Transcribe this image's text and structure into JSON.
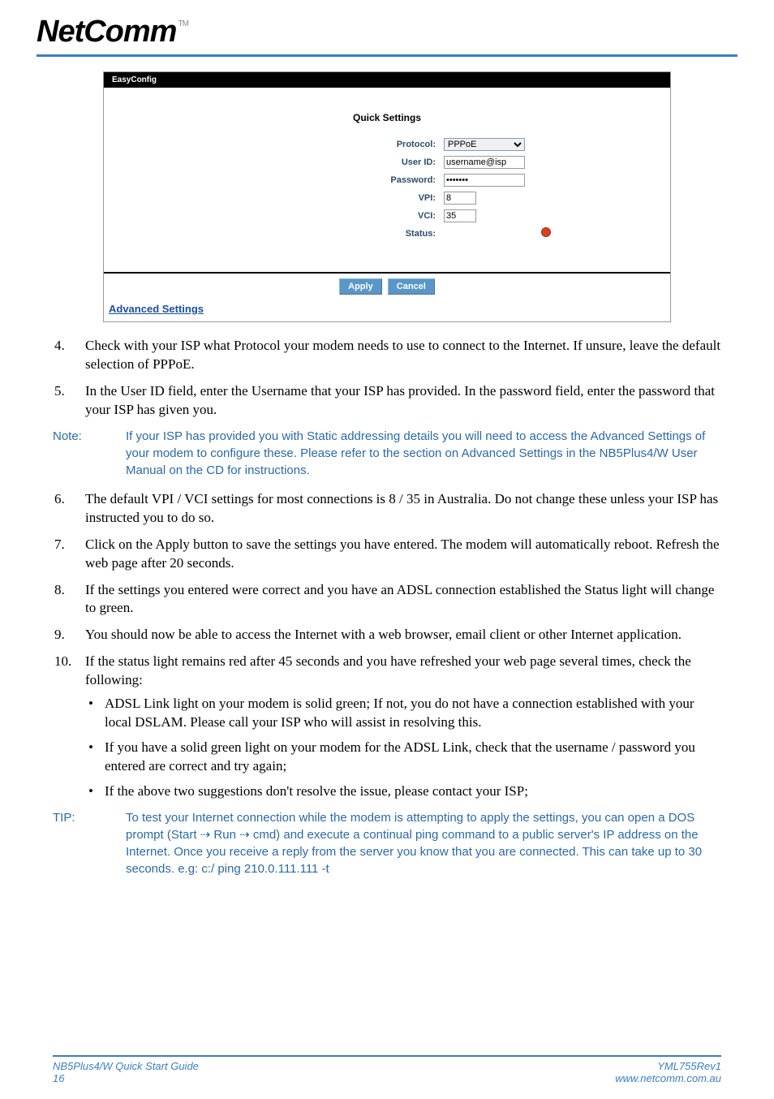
{
  "logo": {
    "text": "NetComm",
    "tm": "TM"
  },
  "screenshot": {
    "tab": "EasyConfig",
    "title": "Quick Settings",
    "fields": {
      "protocol": {
        "label": "Protocol:",
        "value": "PPPoE"
      },
      "userid": {
        "label": "User ID:",
        "value": "username@isp"
      },
      "password": {
        "label": "Password:",
        "value": "•••••••"
      },
      "vpi": {
        "label": "VPI:",
        "value": "8"
      },
      "vci": {
        "label": "VCI:",
        "value": "35"
      },
      "status": {
        "label": "Status:"
      }
    },
    "buttons": {
      "apply": "Apply",
      "cancel": "Cancel"
    },
    "advanced": "Advanced Settings"
  },
  "steps": {
    "s4": "Check with your ISP what Protocol your modem needs to use to connect to the Internet. If unsure, leave the default selection of PPPoE.",
    "s5": "In the User ID field, enter the Username that your ISP has provided. In the password field, enter the password that your ISP has given you.",
    "s6": "The default VPI / VCI settings for most connections is 8 / 35 in Australia. Do not change these unless your ISP has instructed you to do so.",
    "s7": "Click on the Apply button to save the settings you have entered. The modem will automatically reboot. Refresh the web page after 20 seconds.",
    "s8": "If the settings you entered were correct and you have an ADSL connection established the Status light will change to green.",
    "s9": "You should now be able to access the Internet with a web browser, email client or other Internet application.",
    "s10": "If the status light remains red after 45 seconds and you have refreshed your web page several times, check the following:",
    "s10_bullets": {
      "b1": "ADSL Link light on your modem is solid green; If not, you do not have a connection established with your local DSLAM. Please call your ISP who will assist in resolving this.",
      "b2": "If you have a solid green light on your modem for the ADSL Link, check that the username / password you entered are correct and try again;",
      "b3": "If the above two suggestions don't resolve the issue, please contact your ISP;"
    }
  },
  "note": {
    "label": "Note:",
    "text": "If your ISP has provided you with Static addressing details you will need to access the Advanced Settings of your modem to configure these. Please refer to the section on Advanced Settings in the NB5Plus4/W User Manual on the CD for instructions."
  },
  "tip": {
    "label": "TIP:",
    "text": "To test your Internet connection while the modem is attempting to apply the settings, you can open a DOS prompt (Start ⇢ Run ⇢ cmd) and execute a continual ping command to a public server's IP address on the Internet. Once you receive a reply from the server you know that you are connected. This can take up to 30 seconds. e.g:  c:/  ping 210.0.111.111 -t"
  },
  "footer": {
    "left1": "NB5Plus4/W Quick Start Guide",
    "left2": "16",
    "right1": "YML755Rev1",
    "right2": "www.netcomm.com.au"
  }
}
